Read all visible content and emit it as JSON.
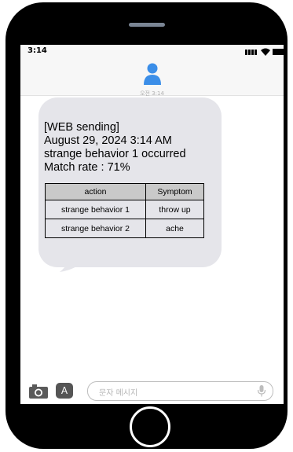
{
  "status_bar": {
    "time": "3:14"
  },
  "conversation": {
    "timestamp": "오전 3:14",
    "message_lines": [
      "[WEB sending]",
      "August 29, 2024 3:14 AM",
      "strange behavior 1 occurred",
      "Match rate : 71%"
    ],
    "table": {
      "headers": [
        "action",
        "Symptom"
      ],
      "rows": [
        [
          "strange behavior 1",
          "throw up"
        ],
        [
          "strange behavior 2",
          "ache"
        ]
      ]
    }
  },
  "composer": {
    "placeholder": "문자 메시지",
    "app_icon_glyph": "A"
  },
  "colors": {
    "bubble": "#e5e5ea",
    "avatar": "#3b8ee8",
    "phone_body": "#000000"
  },
  "icons": [
    "signal-icon",
    "wifi-icon",
    "battery-icon",
    "avatar-icon",
    "camera-icon",
    "app-store-icon",
    "microphone-icon",
    "home-button"
  ]
}
